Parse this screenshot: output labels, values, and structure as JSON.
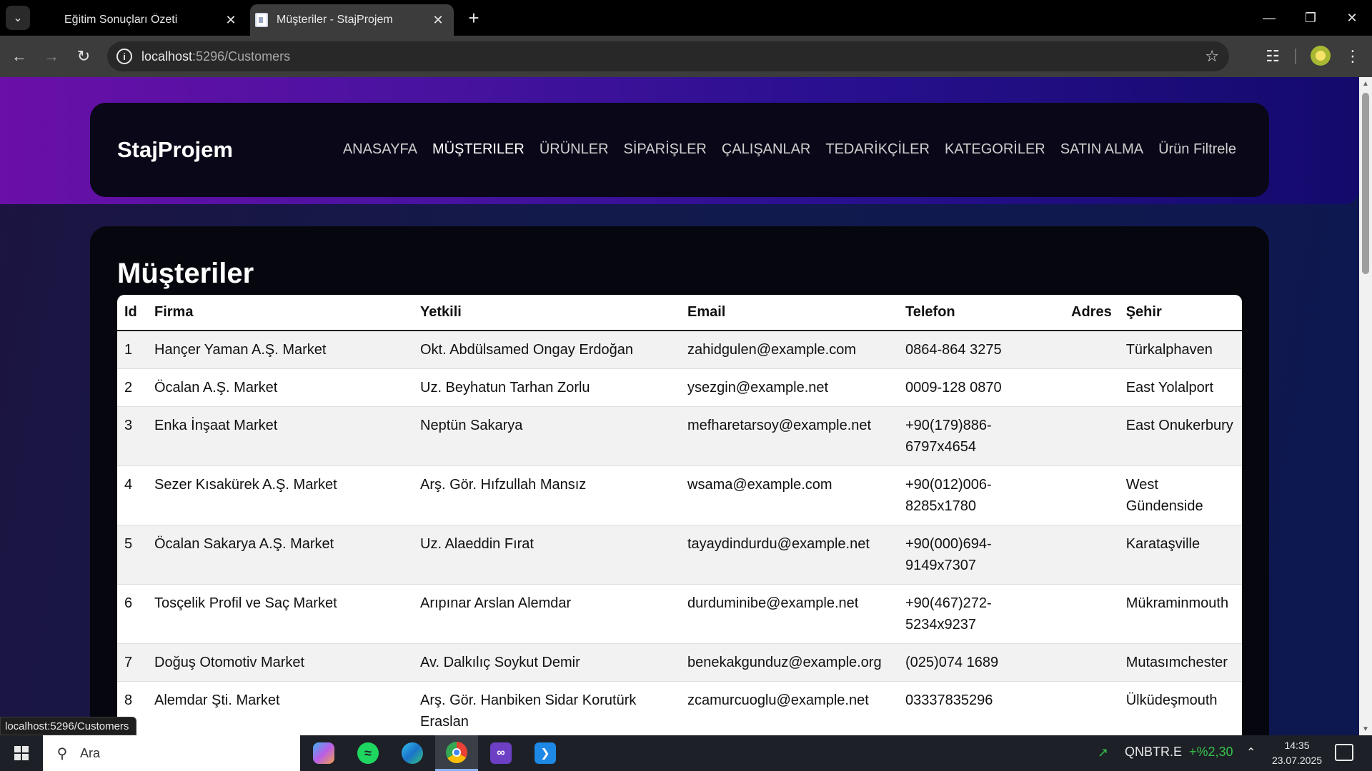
{
  "browser": {
    "tabs": [
      {
        "title": "Eğitim Sonuçları Özeti",
        "active": false
      },
      {
        "title": "Müşteriler - StajProjem",
        "active": true
      }
    ],
    "url_host": "localhost",
    "url_path": ":5296/Customers",
    "status_link": "localhost:5296/Customers",
    "icons": {
      "tab_search": "chevron-down-icon",
      "tab_close": "close-icon",
      "new_tab": "plus-icon",
      "back": "arrow-left-icon",
      "forward": "arrow-right-icon",
      "reload": "reload-icon",
      "site_info": "info-icon",
      "bookmark": "star-icon",
      "extensions": "puzzle-icon",
      "menu": "kebab-menu-icon"
    }
  },
  "site": {
    "brand": "StajProjem",
    "nav": [
      {
        "label": "ANASAYFA",
        "active": false
      },
      {
        "label": "MÜŞTERILER",
        "active": true
      },
      {
        "label": "ÜRÜNLER",
        "active": false
      },
      {
        "label": "SİPARİŞLER",
        "active": false
      },
      {
        "label": "ÇALIŞANLAR",
        "active": false
      },
      {
        "label": "TEDARİKÇİLER",
        "active": false
      },
      {
        "label": "KATEGORİLER",
        "active": false
      },
      {
        "label": "SATIN ALMA",
        "active": false
      },
      {
        "label": "Ürün Filtrele",
        "active": false
      }
    ],
    "colors": {
      "hero_start": "#6a0fa8",
      "hero_end": "#130a6c",
      "card_bg": "#06070e"
    }
  },
  "page": {
    "title": "Müşteriler",
    "columns": [
      "Id",
      "Firma",
      "Yetkili",
      "Email",
      "Telefon",
      "Adres",
      "Şehir"
    ],
    "rows": [
      {
        "id": "1",
        "firma": "Hançer Yaman A.Ş. Market",
        "yetkili": "Okt. Abdülsamed Ongay Erdoğan",
        "email": "zahidgulen@example.com",
        "telefon": "0864-864 3275",
        "adres": "",
        "sehir": "Türkalphaven"
      },
      {
        "id": "2",
        "firma": "Öcalan A.Ş. Market",
        "yetkili": "Uz. Beyhatun Tarhan Zorlu",
        "email": "ysezgin@example.net",
        "telefon": "0009-128 0870",
        "adres": "",
        "sehir": "East Yolalport"
      },
      {
        "id": "3",
        "firma": "Enka İnşaat Market",
        "yetkili": "Neptün Sakarya",
        "email": "mefharetarsoy@example.net",
        "telefon": "+90(179)886-6797x4654",
        "adres": "",
        "sehir": "East Onukerbury"
      },
      {
        "id": "4",
        "firma": "Sezer Kısakürek A.Ş. Market",
        "yetkili": "Arş. Gör. Hıfzullah Mansız",
        "email": "wsama@example.com",
        "telefon": "+90(012)006-8285x1780",
        "adres": "",
        "sehir": "West Gündenside"
      },
      {
        "id": "5",
        "firma": "Öcalan Sakarya A.Ş. Market",
        "yetkili": "Uz. Alaeddin Fırat",
        "email": "tayaydindurdu@example.net",
        "telefon": "+90(000)694-9149x7307",
        "adres": "",
        "sehir": "Karataşville"
      },
      {
        "id": "6",
        "firma": "Tosçelik Profil ve Saç Market",
        "yetkili": "Arıpınar Arslan Alemdar",
        "email": "durduminibe@example.net",
        "telefon": "+90(467)272-5234x9237",
        "adres": "",
        "sehir": "Mükraminmouth"
      },
      {
        "id": "7",
        "firma": "Doğuş Otomotiv Market",
        "yetkili": "Av. Dalkılıç Soykut Demir",
        "email": "benekakgunduz@example.org",
        "telefon": "(025)074 1689",
        "adres": "",
        "sehir": "Mutasımchester"
      },
      {
        "id": "8",
        "firma": "Alemdar Şti. Market",
        "yetkili": "Arş. Gör. Hanbiken Sidar Korutürk Eraslan",
        "email": "zcamurcuoglu@example.net",
        "telefon": "03337835296",
        "adres": "",
        "sehir": "Ülküdeşmouth"
      }
    ]
  },
  "taskbar": {
    "search_placeholder": "Ara",
    "apps": [
      "copilot-icon",
      "spotify-icon",
      "edge-icon",
      "chrome-icon",
      "visual-studio-icon",
      "vscode-icon"
    ],
    "stock_name": "QNBTR.E",
    "stock_change": "+%2,30",
    "time": "14:35",
    "date": "23.07.2025"
  }
}
